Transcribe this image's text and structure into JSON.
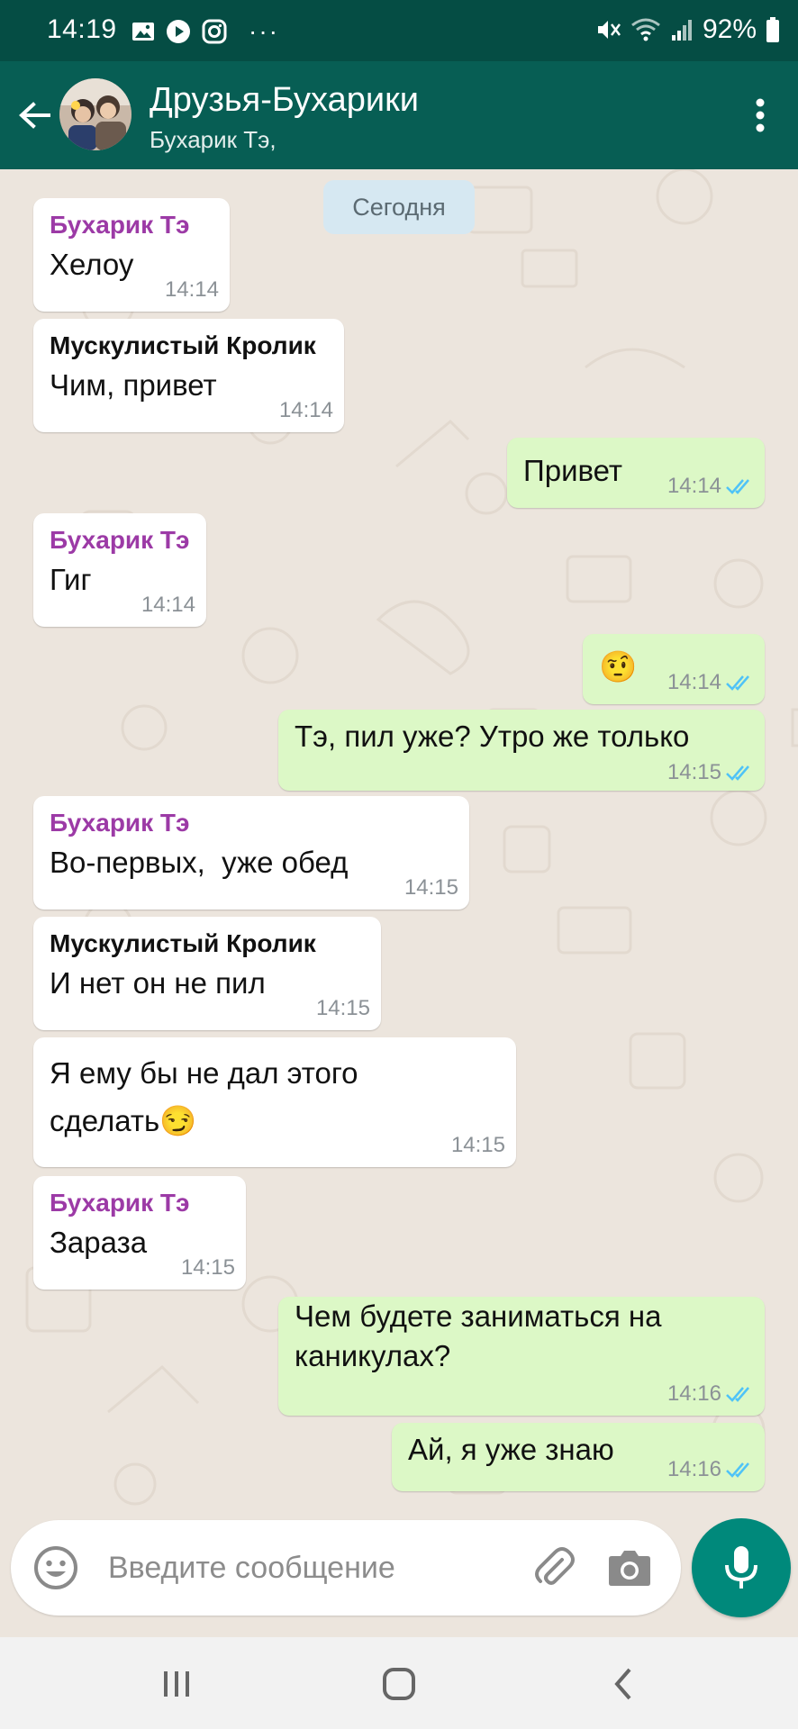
{
  "status_bar": {
    "time": "14:19",
    "more": "···",
    "battery": "92%",
    "icons": [
      "gallery-icon",
      "play-icon",
      "instagram-icon",
      "mute-icon",
      "wifi-icon",
      "signal-icon",
      "battery-icon"
    ]
  },
  "header": {
    "title": "Друзья-Бухарики",
    "subtitle": "Бухарик Тэ,"
  },
  "chat": {
    "date_label": "Сегодня",
    "messages": [
      {
        "dir": "in",
        "sender": "Бухарик Тэ",
        "sender_color": "#9c3aa6",
        "lines": [
          "Хелоу"
        ],
        "time": "14:14"
      },
      {
        "dir": "in",
        "sender": "Мускулистый Кролик",
        "sender_color": "#111111",
        "lines": [
          "Чим, привет"
        ],
        "time": "14:14"
      },
      {
        "dir": "out",
        "lines": [
          "Привет"
        ],
        "time": "14:14",
        "read": true
      },
      {
        "dir": "in",
        "sender": "Бухарик Тэ",
        "sender_color": "#9c3aa6",
        "lines": [
          "Гиг"
        ],
        "time": "14:14"
      },
      {
        "dir": "out",
        "lines": [
          "🤨"
        ],
        "time": "14:14",
        "read": true
      },
      {
        "dir": "out",
        "lines": [
          "Тэ, пил уже? Утро же только"
        ],
        "time": "14:15",
        "read": true
      },
      {
        "dir": "in",
        "sender": "Бухарик Тэ",
        "sender_color": "#9c3aa6",
        "lines": [
          "Во-первых,  уже обед"
        ],
        "time": "14:15"
      },
      {
        "dir": "in",
        "sender": "Мускулистый Кролик",
        "sender_color": "#111111",
        "lines": [
          "И нет он не пил"
        ],
        "time": "14:15"
      },
      {
        "dir": "in",
        "lines": [
          "Я ему бы не дал этого",
          "сделать😏"
        ],
        "time": "14:15"
      },
      {
        "dir": "in",
        "sender": "Бухарик Тэ",
        "sender_color": "#9c3aa6",
        "lines": [
          "Зараза"
        ],
        "time": "14:15"
      },
      {
        "dir": "out",
        "lines": [
          "Чем будете заниматься на",
          "каникулах?"
        ],
        "time": "14:16",
        "read": true
      },
      {
        "dir": "out",
        "lines": [
          "Ай, я уже знаю"
        ],
        "time": "14:16",
        "read": true
      }
    ]
  },
  "composer": {
    "placeholder": "Введите сообщение"
  },
  "colors": {
    "status_bar": "#054d44",
    "app_bar": "#075e54",
    "chat_bg": "#ece5dd",
    "bubble_out": "#dcf8c6",
    "bubble_in": "#ffffff",
    "read_ticks": "#4fc3f7",
    "mic_button": "#00897b"
  }
}
